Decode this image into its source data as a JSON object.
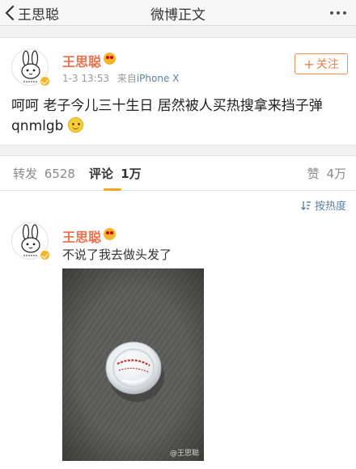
{
  "navbar": {
    "back_label": "王思聪",
    "title": "微博正文",
    "more_icon": "more-dots-icon"
  },
  "post": {
    "author": "王思聪",
    "timestamp": "1-3 13:53",
    "source_prefix": "来自",
    "source": "iPhone X",
    "follow_label": "关注",
    "text": "呵呵 老子今儿三十生日 居然被人买热搜拿来挡子弹 qnmlgb",
    "emoji": "smile-emoji"
  },
  "tabs": {
    "repost_label": "转发",
    "repost_count": "6528",
    "comments_label": "评论",
    "comments_count": "1万",
    "likes_label": "赞",
    "likes_count": "4万"
  },
  "comments": {
    "sort_label": "按热度",
    "items": [
      {
        "author": "王思聪",
        "text": "不说了我去做头发了",
        "photo_watermark": "@王思聪"
      }
    ]
  },
  "colors": {
    "username": "#eb7350",
    "link": "#5d7fae",
    "follow_border": "#f58c5a",
    "tab_indicator": "#f6a623",
    "page_bg": "#f2f2f2"
  }
}
